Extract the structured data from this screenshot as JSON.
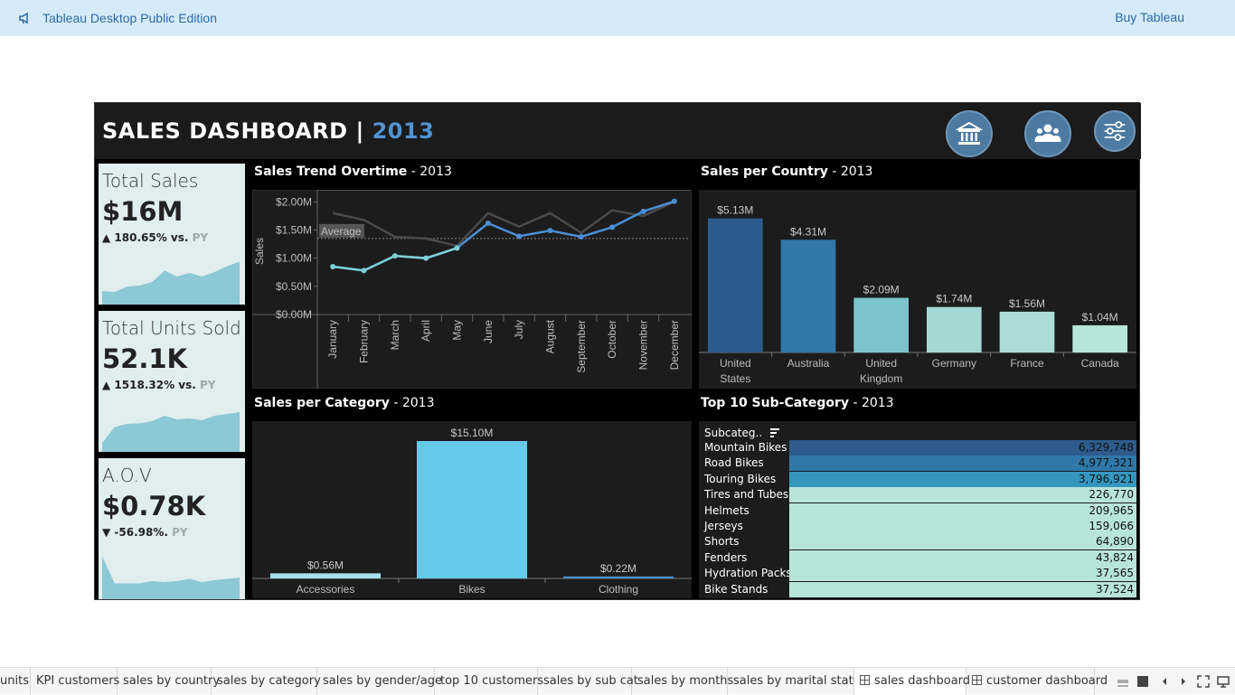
{
  "banner": {
    "title": "Tableau Desktop Public Edition",
    "buy_label": "Buy Tableau"
  },
  "dashboard": {
    "title": "SALES DASHBOARD",
    "separator": " | ",
    "year": "2013",
    "nav_icons": [
      "bank-icon",
      "customers-icon",
      "filters-icon"
    ]
  },
  "kpis": [
    {
      "title": "Total Sales",
      "value": "$16M",
      "arrow": "▲",
      "change": "180.65% vs.",
      "py": "PY",
      "spark": [
        0.3,
        0.28,
        0.4,
        0.42,
        0.5,
        0.75,
        0.62,
        0.7,
        0.62,
        0.72,
        0.85,
        0.95
      ]
    },
    {
      "title": "Total Units Sold",
      "value": "52.1K",
      "arrow": "▲",
      "change": "1518.32% vs.",
      "py": "PY",
      "spark": [
        0.2,
        0.55,
        0.62,
        0.63,
        0.68,
        0.8,
        0.72,
        0.74,
        0.7,
        0.8,
        0.84,
        0.88
      ]
    },
    {
      "title": "A.O.V",
      "value": "$0.78K",
      "arrow": "▼",
      "change": "-56.98%.",
      "py": "PY",
      "spark": [
        0.95,
        0.35,
        0.35,
        0.35,
        0.4,
        0.38,
        0.4,
        0.45,
        0.38,
        0.42,
        0.45,
        0.48
      ]
    }
  ],
  "trend": {
    "title": "Sales Trend Overtime",
    "year": " - 2013",
    "ylabel": "Sales",
    "average_label": "Average"
  },
  "country": {
    "title": "Sales per Country",
    "year": " - 2013"
  },
  "category": {
    "title": "Sales per Category",
    "year": " - 2013"
  },
  "subcat": {
    "title": "Top 10 Sub-Category",
    "year": " - 2013",
    "header": "Subcateg..",
    "rows": [
      {
        "name": "Mountain Bikes",
        "value": "6,329,748",
        "color": "#2d5b8c"
      },
      {
        "name": "Road Bikes",
        "value": "4,977,321",
        "color": "#2f78a8"
      },
      {
        "name": "Touring Bikes",
        "value": "3,796,921",
        "color": "#3597bf"
      },
      {
        "name": "Tires and Tubes",
        "value": "226,770",
        "color": "#b8e5da"
      },
      {
        "name": "Helmets",
        "value": "209,965",
        "color": "#b8e5da"
      },
      {
        "name": "Jerseys",
        "value": "159,066",
        "color": "#b8e5da"
      },
      {
        "name": "Shorts",
        "value": "64,890",
        "color": "#b8e5da"
      },
      {
        "name": "Fenders",
        "value": "43,824",
        "color": "#b8e5da"
      },
      {
        "name": "Hydration Packs",
        "value": "37,565",
        "color": "#b8e5da"
      },
      {
        "name": "Bike Stands",
        "value": "37,524",
        "color": "#b8e5da"
      }
    ]
  },
  "chart_data": [
    {
      "type": "line",
      "title": "Sales Trend Overtime - 2013",
      "ylabel": "Sales",
      "x": [
        "January",
        "February",
        "March",
        "April",
        "May",
        "June",
        "July",
        "August",
        "September",
        "October",
        "November",
        "December"
      ],
      "yticks": [
        "$0.00M",
        "$0.50M",
        "$1.00M",
        "$1.50M",
        "$2.00M"
      ],
      "ylim": [
        0,
        2.15
      ],
      "average": 1.35,
      "series": [
        {
          "values": [
            0.85,
            0.78,
            1.04,
            1.0,
            1.18,
            1.62,
            1.39,
            1.49,
            1.38,
            1.55,
            1.83,
            2.01
          ],
          "color": "#4a8fd6"
        },
        {
          "values": [
            1.8,
            1.68,
            1.38,
            1.35,
            1.22,
            1.8,
            1.56,
            1.8,
            1.45,
            1.85,
            1.75,
            2.0
          ],
          "color": "#4a4a4a"
        }
      ]
    },
    {
      "type": "bar",
      "title": "Sales per Country - 2013",
      "categories": [
        "United States",
        "Australia",
        "United Kingdom",
        "Germany",
        "France",
        "Canada"
      ],
      "values": [
        5.13,
        4.31,
        2.09,
        1.74,
        1.56,
        1.04
      ],
      "labels": [
        "$5.13M",
        "$4.31M",
        "$2.09M",
        "$1.74M",
        "$1.56M",
        "$1.04M"
      ],
      "colors": [
        "#2d5b8c",
        "#2f78a8",
        "#7cc4cc",
        "#a3d8d4",
        "#aadcd8",
        "#b8e5da"
      ],
      "ylim": [
        0,
        5.6
      ]
    },
    {
      "type": "bar",
      "title": "Sales per Category - 2013",
      "categories": [
        "Accessories",
        "Bikes",
        "Clothing"
      ],
      "values": [
        0.56,
        15.1,
        0.22
      ],
      "labels": [
        "$0.56M",
        "$15.10M",
        "$0.22M"
      ],
      "colors": [
        "#a3e3ef",
        "#66cbea",
        "#4a90d0"
      ],
      "ylim": [
        0,
        15.5
      ]
    },
    {
      "type": "bar",
      "title": "Top 10 Sub-Category - 2013",
      "categories": [
        "Mountain Bikes",
        "Road Bikes",
        "Touring Bikes",
        "Tires and Tubes",
        "Helmets",
        "Jerseys",
        "Shorts",
        "Fenders",
        "Hydration Packs",
        "Bike Stands"
      ],
      "values": [
        6329748,
        4977321,
        3796921,
        226770,
        209965,
        159066,
        64890,
        43824,
        37565,
        37524
      ]
    }
  ],
  "tabs": [
    {
      "label": "units",
      "icon": false,
      "active": false
    },
    {
      "label": "KPI customers",
      "icon": false,
      "active": false
    },
    {
      "label": "sales by country",
      "icon": false,
      "active": false
    },
    {
      "label": "sales by category",
      "icon": false,
      "active": false
    },
    {
      "label": "sales by gender/age",
      "icon": false,
      "active": false
    },
    {
      "label": "top 10 customers",
      "icon": false,
      "active": false
    },
    {
      "label": "sales by sub cat",
      "icon": false,
      "active": false
    },
    {
      "label": "sales by months",
      "icon": false,
      "active": false
    },
    {
      "label": "sales by marital status",
      "icon": false,
      "active": false
    },
    {
      "label": "sales dashboard",
      "icon": true,
      "active": true
    },
    {
      "label": "customer dashboard",
      "icon": true,
      "active": false
    }
  ]
}
